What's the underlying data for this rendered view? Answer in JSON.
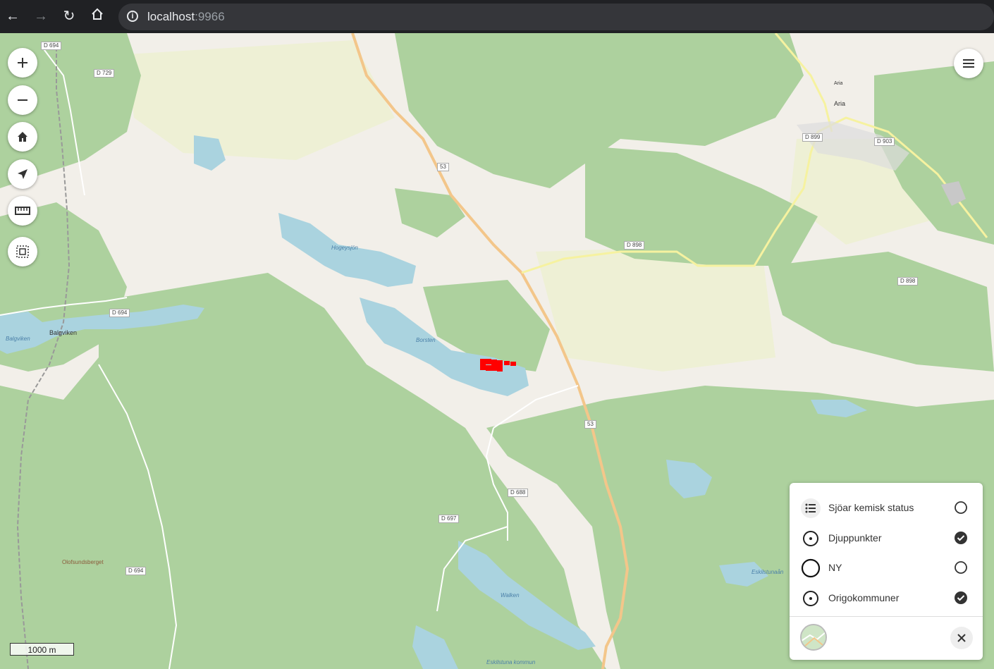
{
  "browser": {
    "url_host": "localhost",
    "url_port": ":9966",
    "back_icon": "arrow-left-icon",
    "forward_icon": "arrow-right-icon",
    "reload_icon": "reload-icon",
    "home_icon": "home-icon"
  },
  "map": {
    "road_labels": [
      "D 694",
      "D 729",
      "D 694",
      "53",
      "53",
      "D 899",
      "D 903",
      "D 898",
      "D 898",
      "D 688",
      "D 697",
      "D 694"
    ],
    "place_labels": [
      "Balgviken",
      "Aria",
      "Aria",
      "Olofsundsberget"
    ],
    "water_labels": [
      "Hogeysjön",
      "Borsten",
      "Balgviken",
      "Walken",
      "Eskilstunaån",
      "Eskilstuna kommun"
    ],
    "scale_label": "1000 m",
    "markers_color": "#ff0000"
  },
  "controls": {
    "zoom_in_icon": "plus-icon",
    "zoom_out_icon": "minus-icon",
    "home_icon": "home-icon",
    "locate_icon": "location-arrow-icon",
    "measure_icon": "ruler-icon",
    "extent_icon": "extent-select-icon",
    "menu_icon": "hamburger-menu-icon"
  },
  "legend": {
    "items": [
      {
        "label": "Sjöar kemisk status",
        "icon": "list-icon",
        "checked": false
      },
      {
        "label": "Djuppunkter",
        "icon": "dot-circle-icon",
        "checked": true
      },
      {
        "label": "NY",
        "icon": "circle-icon",
        "checked": false
      },
      {
        "label": "Origokommuner",
        "icon": "dot-circle-icon",
        "checked": true
      }
    ],
    "close_icon": "close-icon",
    "basemap_icon": "basemap-thumbnail-icon"
  }
}
